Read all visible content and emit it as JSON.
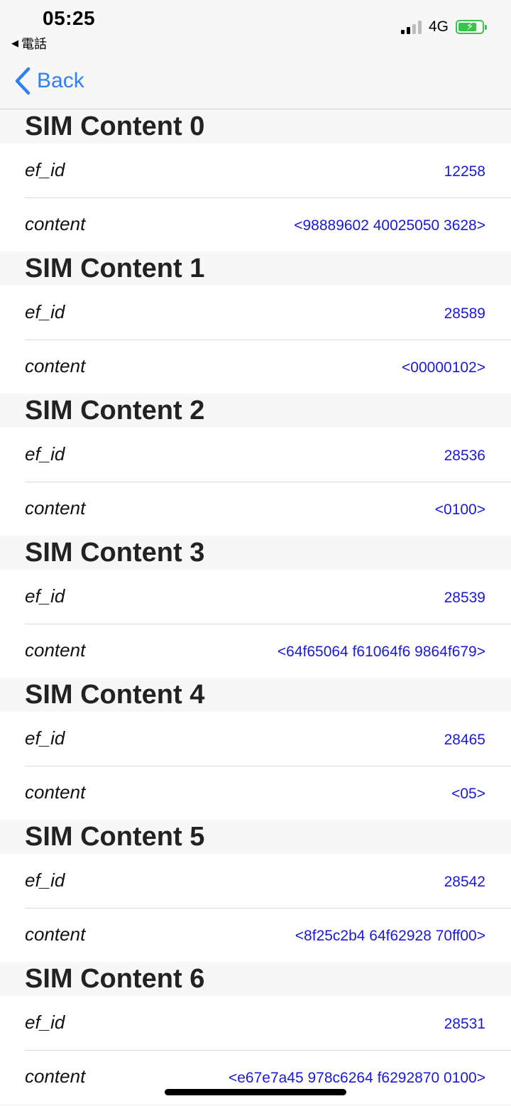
{
  "status_bar": {
    "time": "05:25",
    "back_app": "電話",
    "network": "4G",
    "battery_bolt": "⚡",
    "battery_level": 0.8
  },
  "nav": {
    "back_label": "Back"
  },
  "sections": [
    {
      "title": "SIM Content 0",
      "rows": [
        {
          "key": "ef_id",
          "value": "12258"
        },
        {
          "key": "content",
          "value": "<98889602 40025050 3628>"
        }
      ]
    },
    {
      "title": "SIM Content 1",
      "rows": [
        {
          "key": "ef_id",
          "value": "28589"
        },
        {
          "key": "content",
          "value": "<00000102>"
        }
      ]
    },
    {
      "title": "SIM Content 2",
      "rows": [
        {
          "key": "ef_id",
          "value": "28536"
        },
        {
          "key": "content",
          "value": "<0100>"
        }
      ]
    },
    {
      "title": "SIM Content 3",
      "rows": [
        {
          "key": "ef_id",
          "value": "28539"
        },
        {
          "key": "content",
          "value": "<64f65064 f61064f6 9864f679>"
        }
      ]
    },
    {
      "title": "SIM Content 4",
      "rows": [
        {
          "key": "ef_id",
          "value": "28465"
        },
        {
          "key": "content",
          "value": "<05>"
        }
      ]
    },
    {
      "title": "SIM Content 5",
      "rows": [
        {
          "key": "ef_id",
          "value": "28542"
        },
        {
          "key": "content",
          "value": "<8f25c2b4 64f62928 70ff00>"
        }
      ]
    },
    {
      "title": "SIM Content 6",
      "rows": [
        {
          "key": "ef_id",
          "value": "28531"
        },
        {
          "key": "content",
          "value": "<e67e7a45 978c6264 f6292870 0100>"
        }
      ]
    }
  ]
}
